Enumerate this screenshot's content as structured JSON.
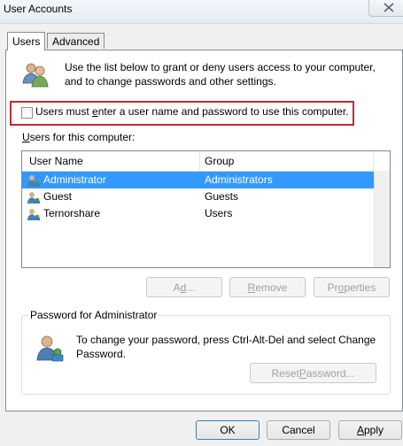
{
  "window": {
    "title": "User Accounts",
    "close_icon": "close-icon"
  },
  "tabs": [
    {
      "label": "Users",
      "active": true
    },
    {
      "label": "Advanced",
      "active": false
    }
  ],
  "intro": {
    "icon": "users-icon",
    "text_line1": "Use the list below to grant or deny users access to your computer,",
    "text_line2": "and to change passwords and other settings."
  },
  "require_login": {
    "checked": false,
    "label_pre": "Users must ",
    "label_key": "e",
    "label_post": "nter a user name and password to use this computer."
  },
  "users_section": {
    "label_key": "U",
    "label_post": "sers for this computer:"
  },
  "user_list": {
    "columns": [
      "User Name",
      "Group"
    ],
    "rows": [
      {
        "name": "Administrator",
        "group": "Administrators",
        "selected": true
      },
      {
        "name": "Guest",
        "group": "Guests",
        "selected": false
      },
      {
        "name": "Ternorshare",
        "group": "Users",
        "selected": false
      }
    ]
  },
  "list_buttons": {
    "add": {
      "key": "d",
      "pre": "A",
      "post": "...",
      "disabled": true
    },
    "remove": {
      "key": "R",
      "pre": "",
      "post": "emove",
      "disabled": true
    },
    "properties": {
      "key": "o",
      "pre": "Pr",
      "post": "perties",
      "disabled": true
    }
  },
  "password_group": {
    "legend": "Password for Administrator",
    "icon": "user-key-icon",
    "text_line1": "To change your password, press Ctrl-Alt-Del and select Change",
    "text_line2": "Password.",
    "reset": {
      "pre": "Reset ",
      "key": "P",
      "post": "assword...",
      "disabled": true
    }
  },
  "footer": {
    "ok": "OK",
    "cancel": "Cancel",
    "apply": {
      "pre": "",
      "key": "A",
      "post": "pply"
    }
  }
}
